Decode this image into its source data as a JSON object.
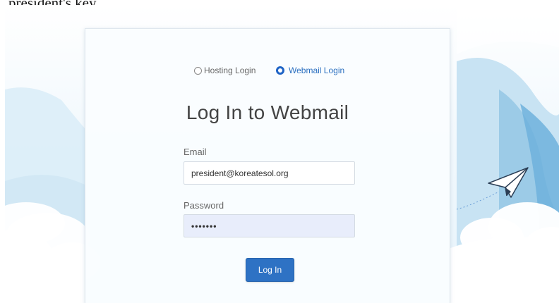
{
  "caption": "president's key",
  "login_type": {
    "options": [
      {
        "label": "Hosting Login",
        "selected": false
      },
      {
        "label": "Webmail Login",
        "selected": true
      }
    ]
  },
  "heading": "Log In to Webmail",
  "form": {
    "email_label": "Email",
    "email_value": "president@koreatesol.org",
    "password_label": "Password",
    "password_value": "•••••••",
    "submit_label": "Log In"
  },
  "colors": {
    "accent": "#2e72c4",
    "radio_selected": "#1f64c6",
    "password_autofill_bg": "#e8edfb",
    "background_sky": "#e6f3fb"
  },
  "icons": {
    "decoration": "paper-plane-icon"
  }
}
